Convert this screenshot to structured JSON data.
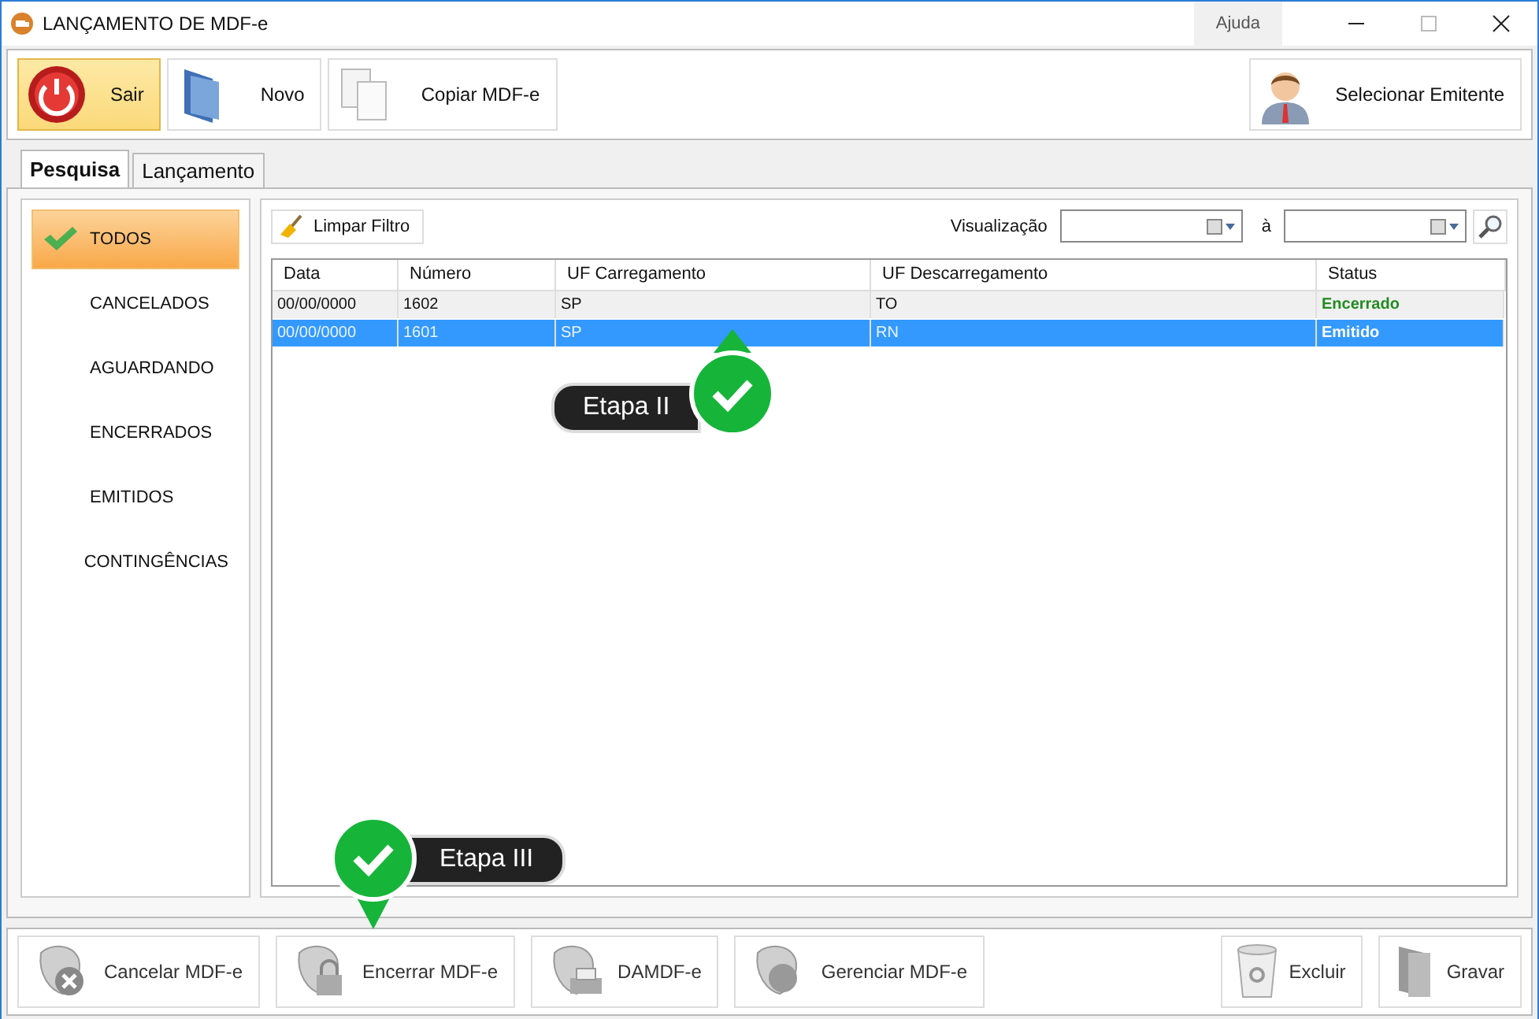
{
  "window": {
    "title": "LANÇAMENTO DE MDF-e",
    "help": "Ajuda"
  },
  "toolbar": {
    "buttons": [
      {
        "label": "Sair",
        "kind": "power",
        "selected": true
      },
      {
        "label": "Novo",
        "kind": "folder",
        "selected": false
      },
      {
        "label": "Copiar MDF-e",
        "kind": "copy",
        "selected": false
      }
    ],
    "right_button": {
      "label": "Selecionar Emitente",
      "kind": "user"
    }
  },
  "tabs": [
    {
      "label": "Pesquisa",
      "selected": true
    },
    {
      "label": "Lançamento",
      "selected": false
    }
  ],
  "filters": [
    {
      "label": "TODOS",
      "selected": true
    },
    {
      "label": "CANCELADOS",
      "selected": false
    },
    {
      "label": "AGUARDANDO",
      "selected": false
    },
    {
      "label": "ENCERRADOS",
      "selected": false
    },
    {
      "label": "EMITIDOS",
      "selected": false
    },
    {
      "label": "CONTINGÊNCIAS",
      "selected": false
    }
  ],
  "filter_bar": {
    "clear_button": "Limpar Filtro",
    "view_label": "Visualização",
    "to_label": "à"
  },
  "table": {
    "columns": [
      "Data",
      "Número",
      "UF Carregamento",
      "UF Descarregamento",
      "Status"
    ],
    "rows": [
      {
        "cells": [
          "00/00/0000",
          "1602",
          "SP",
          "TO",
          "Encerrado"
        ],
        "selected": false
      },
      {
        "cells": [
          "00/00/0000",
          "1601",
          "SP",
          "RN",
          "Emitido"
        ],
        "selected": true
      }
    ]
  },
  "callouts": [
    {
      "label": "Etapa II"
    },
    {
      "label": "Etapa III"
    }
  ],
  "actions": [
    {
      "label": "Cancelar MDF-e",
      "kind": "cancel"
    },
    {
      "label": "Encerrar MDF-e",
      "kind": "lock"
    },
    {
      "label": "DAMDF-e",
      "kind": "print"
    },
    {
      "label": "Gerenciar MDF-e",
      "kind": "manage"
    }
  ],
  "right_actions": [
    {
      "label": "Excluir",
      "kind": "trash"
    },
    {
      "label": "Gravar",
      "kind": "book"
    }
  ]
}
